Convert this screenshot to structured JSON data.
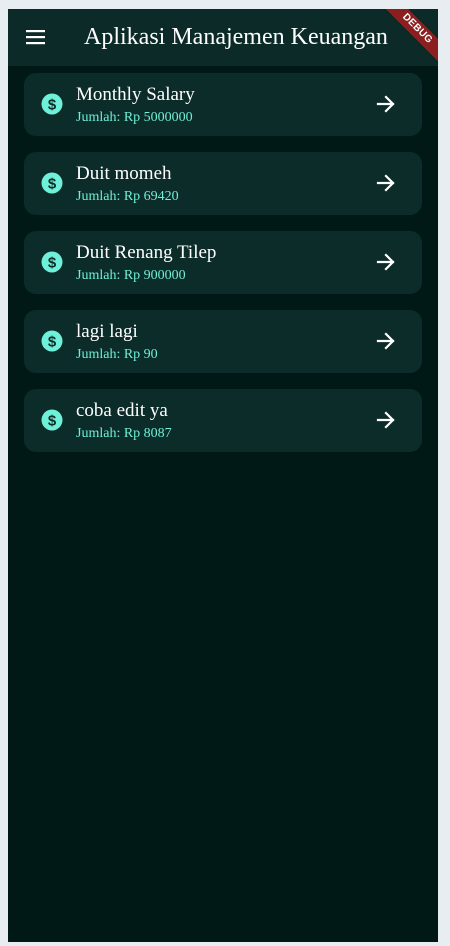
{
  "app": {
    "title": "Aplikasi Manajemen Keuangan",
    "debug_label": "DEBUG"
  },
  "icons": {
    "menu": "menu-icon",
    "item": "dollar-coin-icon",
    "action": "arrow-right-icon"
  },
  "colors": {
    "background": "#001917",
    "appbar": "#0b2a28",
    "card": "#0c2c2a",
    "accent": "#6ff0d8",
    "debug_banner": "#8b1f1f"
  },
  "transactions": [
    {
      "name": "Monthly Salary",
      "amount": "Jumlah: Rp 5000000"
    },
    {
      "name": "Duit momeh",
      "amount": "Jumlah: Rp 69420"
    },
    {
      "name": "Duit Renang Tilep",
      "amount": "Jumlah: Rp 900000"
    },
    {
      "name": "lagi lagi",
      "amount": "Jumlah: Rp 90"
    },
    {
      "name": "coba edit ya",
      "amount": "Jumlah: Rp 8087"
    }
  ]
}
